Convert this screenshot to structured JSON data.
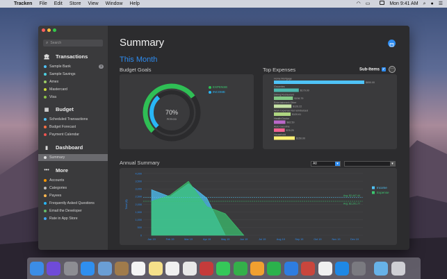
{
  "menubar": {
    "apple": "",
    "app_name": "Tracken",
    "menus": [
      "File",
      "Edit",
      "Store",
      "View",
      "Window",
      "Help"
    ],
    "clock": "Mon 9:41 AM"
  },
  "sidebar": {
    "search_placeholder": "Search",
    "transactions": {
      "title": "Transactions",
      "items": [
        {
          "label": "Sample Bank",
          "color": "#4fc3f7",
          "badge": "3"
        },
        {
          "label": "Sample Savings",
          "color": "#4dd0e1"
        },
        {
          "label": "Amex",
          "color": "#9ccc65"
        },
        {
          "label": "Mastercard",
          "color": "#cddc39"
        },
        {
          "label": "Visa",
          "color": "#8bc34a"
        }
      ]
    },
    "budget": {
      "title": "Budget",
      "items": [
        {
          "label": "Scheduled Transactions",
          "color": "#4fc3f7"
        },
        {
          "label": "Budget Forecast",
          "color": "#ff7043"
        },
        {
          "label": "Payment Calendar",
          "color": "#ef5350"
        }
      ]
    },
    "dashboard": {
      "title": "Dashboard",
      "items": [
        {
          "label": "Summary",
          "color": "#e0e0e0"
        }
      ]
    },
    "more": {
      "title": "More",
      "items": [
        {
          "label": "Accounts",
          "color": "#ff9800"
        },
        {
          "label": "Categories",
          "color": "#bdbdbd"
        },
        {
          "label": "Payees",
          "color": "#ffb74d"
        },
        {
          "label": "Frequently Asked Questions",
          "color": "#29b6f6"
        },
        {
          "label": "Email the Developer",
          "color": "#66bb6a"
        },
        {
          "label": "Rate in App Store",
          "color": "#42a5f5"
        }
      ]
    }
  },
  "main": {
    "title": "Summary",
    "period": "This Month",
    "budget_goals": {
      "label": "Budget Goals",
      "percent_text": "70%",
      "period_text": "PERIOD",
      "legend": [
        "EXPENSE",
        "INCOME"
      ],
      "expense_fraction": 0.7,
      "income_fraction": 0.35
    },
    "top_expenses": {
      "label": "Top Expenses",
      "subitems_label": "Sub-Items",
      "items": [
        {
          "label": "Home:Mortgage",
          "value": "$650.00",
          "amount": 650,
          "color": "#4fc3f7"
        },
        {
          "label": "Groceries",
          "value": "$179.00",
          "amount": 179,
          "color": "#4db6ac"
        },
        {
          "label": "Dining:Restaurant",
          "value": "$136.79",
          "amount": 136.79,
          "color": "#81c784"
        },
        {
          "label": "Entertainment:Other",
          "value": "$126.22",
          "amount": 126.22,
          "color": "#c5e1a5"
        },
        {
          "label": "Work Expense:Not reimbursed",
          "value": "$120.61",
          "amount": 120.61,
          "color": "#aed581"
        },
        {
          "label": "Health:Doctor",
          "value": "$82.50",
          "amount": 82.5,
          "color": "#ba68c8"
        },
        {
          "label": "Auto:Gasoline",
          "value": "$78.25",
          "amount": 78.25,
          "color": "#f06292"
        },
        {
          "label": "Household",
          "value": "$150.00",
          "amount": 150,
          "color": "#fff176"
        }
      ]
    },
    "annual_summary": {
      "label": "Annual Summary",
      "filter_value": "All",
      "avg_income_label": "Avg: $2,447.44",
      "avg_expense_label": "Avg: $2,201.77"
    }
  },
  "chart_data": {
    "type": "area",
    "x": [
      "Jan 19",
      "Feb 19",
      "Mar 19",
      "Apr 19",
      "May 19",
      "Jun 19",
      "Jul 19",
      "Aug 19",
      "Sep 19",
      "Oct 19",
      "Nov 19",
      "Dec 19"
    ],
    "ylabel": "Total ($)",
    "ylim": [
      0,
      4000
    ],
    "yticks": [
      "0",
      "500",
      "1,000",
      "1,500",
      "2,000",
      "2,500",
      "3,000",
      "3,500",
      "4,000"
    ],
    "series": [
      {
        "name": "Income",
        "color": "#4fc3f7",
        "values": [
          2950,
          2500,
          3350,
          2400,
          0,
          0,
          null,
          null,
          null,
          null,
          null,
          null
        ]
      },
      {
        "name": "Expense",
        "color": "#3bc66f",
        "values": [
          2200,
          2600,
          3500,
          1850,
          1400,
          0,
          null,
          null,
          null,
          null,
          null,
          null
        ]
      }
    ],
    "averages": [
      2447.44,
      2201.77
    ],
    "legend_position": "right"
  },
  "dock": {
    "apps": [
      {
        "name": "finder-icon",
        "color": "#3b8de6"
      },
      {
        "name": "siri-icon",
        "color": "#6f4bd8"
      },
      {
        "name": "launchpad-icon",
        "color": "#8d8d93"
      },
      {
        "name": "safari-icon",
        "color": "#2f8ff0"
      },
      {
        "name": "preview-icon",
        "color": "#6a9ed6"
      },
      {
        "name": "notes-book-icon",
        "color": "#a07b4b"
      },
      {
        "name": "calendar-icon",
        "color": "#f4f4f4"
      },
      {
        "name": "notes-icon",
        "color": "#f5e08a"
      },
      {
        "name": "reminders-icon",
        "color": "#f0f0f0"
      },
      {
        "name": "photos-icon",
        "color": "#e8e8e8"
      },
      {
        "name": "photobooth-icon",
        "color": "#c53b3b"
      },
      {
        "name": "messages-icon",
        "color": "#35c759"
      },
      {
        "name": "facetime-icon",
        "color": "#34b04a"
      },
      {
        "name": "pages-icon",
        "color": "#f0a030"
      },
      {
        "name": "numbers-icon",
        "color": "#2bb24c"
      },
      {
        "name": "keynote-icon",
        "color": "#2e7de0"
      },
      {
        "name": "tracken-icon",
        "color": "#c9463d"
      },
      {
        "name": "music-icon",
        "color": "#f0f0f0"
      },
      {
        "name": "app-store-icon",
        "color": "#1e88e5"
      },
      {
        "name": "system-preferences-icon",
        "color": "#7a7a80"
      },
      {
        "name": "downloads-folder-icon",
        "color": "#67b2e8"
      },
      {
        "name": "trash-icon",
        "color": "#cfcfd4"
      }
    ]
  }
}
